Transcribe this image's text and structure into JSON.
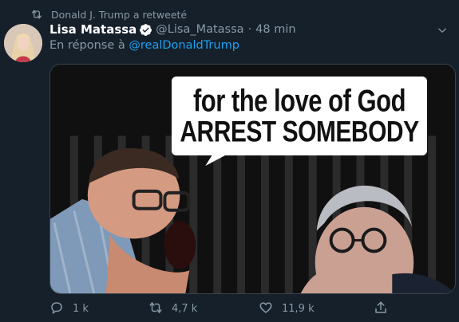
{
  "retweet_context": {
    "text": "Donald J. Trump a retweeté",
    "icon": "retweet-icon"
  },
  "author": {
    "display_name": "Lisa Matassa",
    "verified": true,
    "handle": "@Lisa_Matassa",
    "separator": "·",
    "time": "48 min",
    "avatar_icon": "profile-avatar"
  },
  "reply_to": {
    "prefix": "En réponse à",
    "mention": "@realDonaldTrump"
  },
  "media": {
    "caption_line_1": "for the love of God",
    "caption_line_2": "ARREST SOMEBODY"
  },
  "actions": {
    "reply_count": "1 k",
    "retweet_count": "4,7 k",
    "like_count": "11,9 k"
  },
  "colors": {
    "background": "#15202b",
    "secondary_text": "#8899a6",
    "link": "#1da1f2",
    "border": "#38444d"
  }
}
